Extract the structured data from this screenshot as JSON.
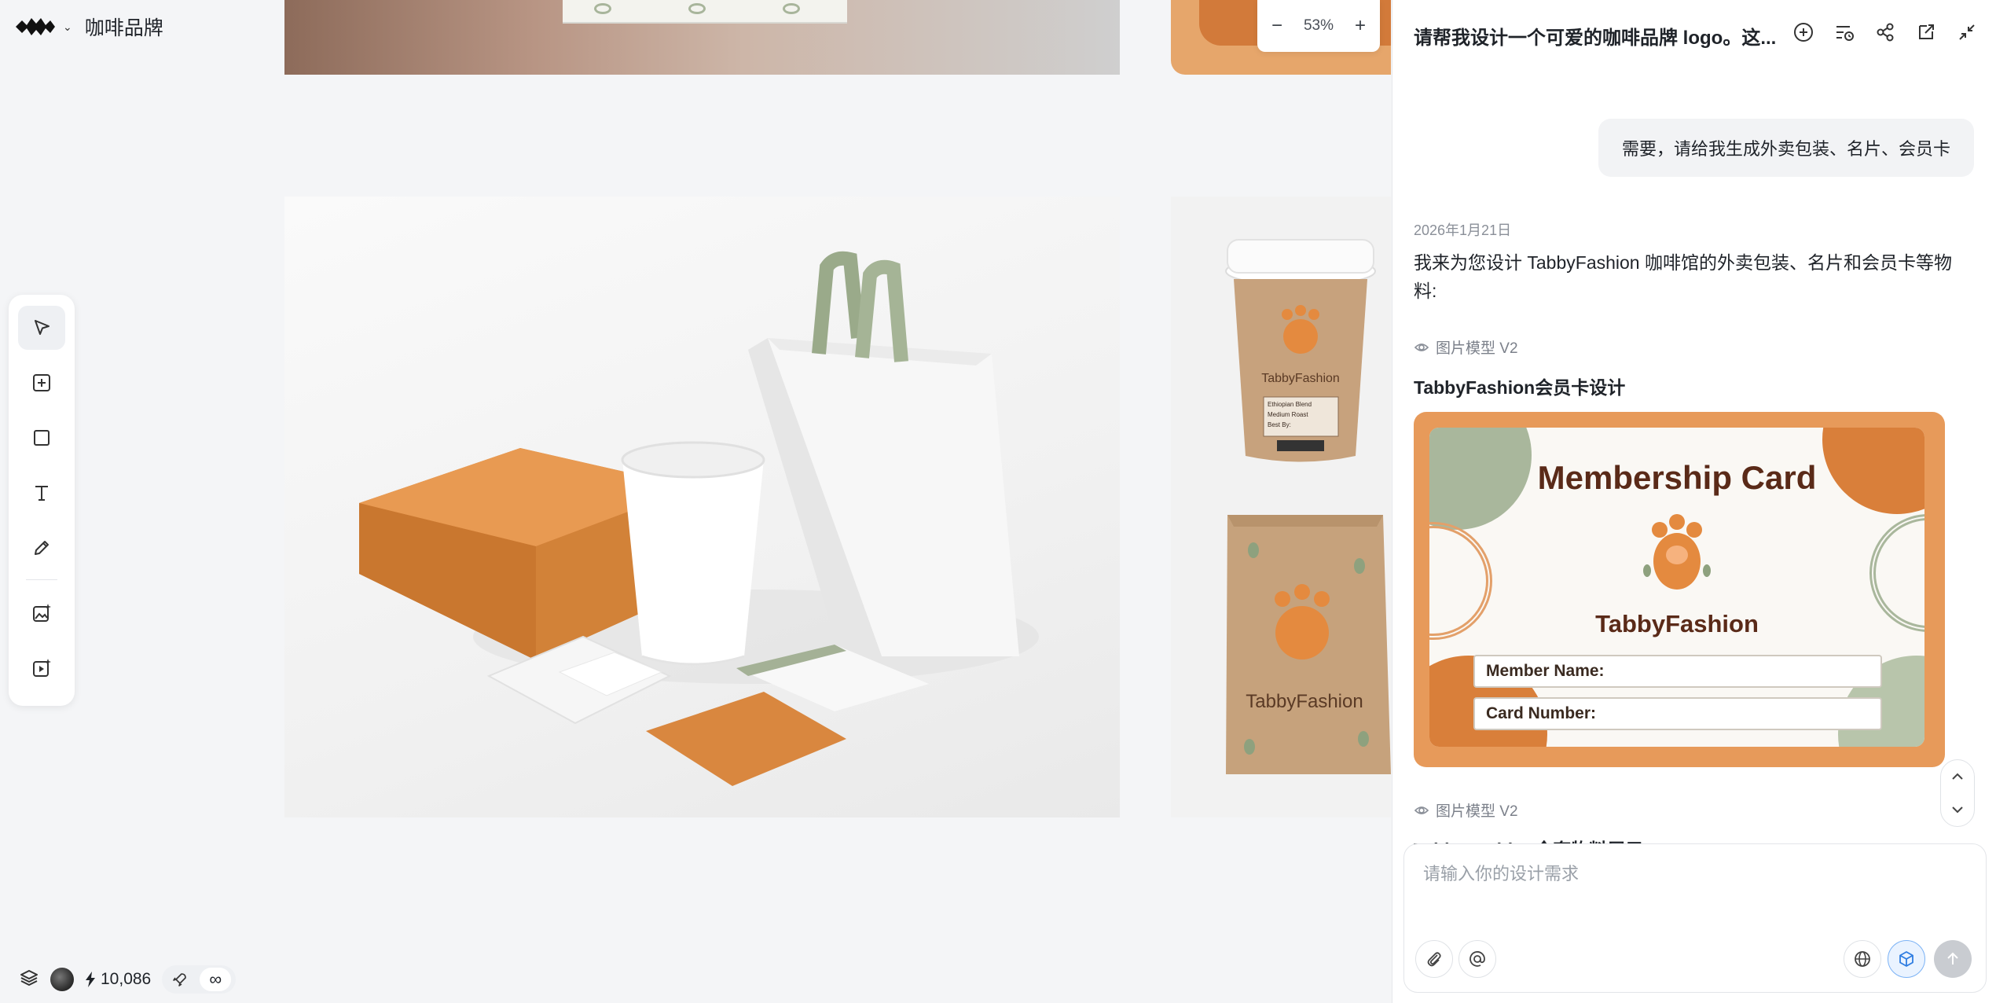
{
  "brand": {
    "project_name": "咖啡品牌"
  },
  "zoom": {
    "minus": "−",
    "level": "53%",
    "plus": "+"
  },
  "canvas": {
    "bag_brand": "TabbyFashion",
    "cup_brand": "TabbyFashion",
    "cup_label_lines": [
      "Ethiopian Blend",
      "Medium Roast",
      "Best By:"
    ]
  },
  "bottom_bar": {
    "credits": "10,086",
    "infinity": "∞"
  },
  "chat": {
    "title": "请帮我设计一个可爱的咖啡品牌 logo。这...",
    "user_message": "需要，请给我生成外卖包装、名片、会员卡",
    "date": "2026年1月21日",
    "assistant_reply": "我来为您设计 TabbyFashion 咖啡馆的外卖包装、名片和会员卡等物料:",
    "model_label_1": "图片模型 V2",
    "image_title_1": "TabbyFashion会员卡设计",
    "card": {
      "heading": "Membership Card",
      "brand": "TabbyFashion",
      "member_name_label": "Member Name:",
      "card_number_label": "Card Number:"
    },
    "model_label_2": "图片模型 V2",
    "image_title_2": "TabbyFashion全套物料展示",
    "input_placeholder": "请输入你的设计需求"
  },
  "colors": {
    "accent": "#2f7de1",
    "card_orange": "#e79a5a",
    "sage": "#a9b79c",
    "kraft": "#c8a27a"
  }
}
